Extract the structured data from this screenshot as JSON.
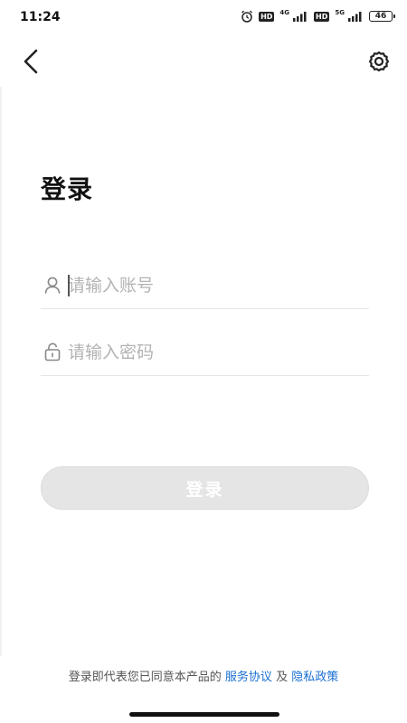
{
  "status_bar": {
    "time": "11:24",
    "hd1": "HD",
    "net1": "4G",
    "hd2": "HD",
    "net2": "5G",
    "battery": "46"
  },
  "top_bar": {
    "back_icon": "chevron-left-icon",
    "settings_icon": "gear-icon"
  },
  "page": {
    "title": "登录"
  },
  "form": {
    "account": {
      "value": "",
      "placeholder": "请输入账号",
      "icon": "user-icon"
    },
    "password": {
      "value": "",
      "placeholder": "请输入密码",
      "icon": "lock-icon"
    },
    "login_label": "登录"
  },
  "footer": {
    "prefix": "登录即代表您已同意本产品的 ",
    "service_link": "服务协议",
    "joiner": " 及 ",
    "privacy_link": "隐私政策"
  },
  "colors": {
    "link": "#1a6fd1",
    "button_disabled": "#e5e5e5",
    "placeholder": "#b3b3b3"
  }
}
